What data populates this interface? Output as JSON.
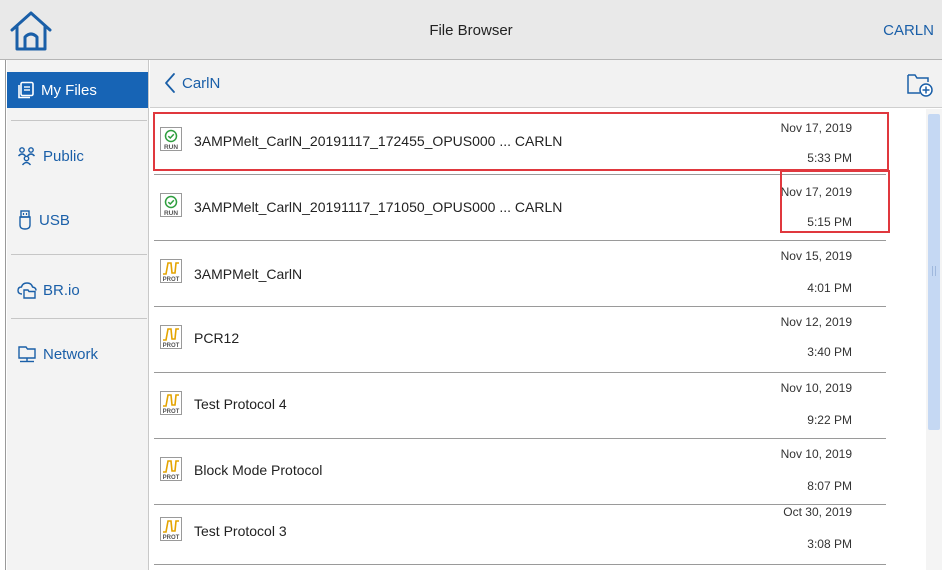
{
  "header": {
    "title": "File Browser",
    "user": "CARLN",
    "home_icon": "home-icon"
  },
  "sidebar": {
    "items": [
      {
        "label": "My Files",
        "icon": "my-files-icon",
        "active": true
      },
      {
        "label": "Public",
        "icon": "public-icon",
        "active": false
      },
      {
        "label": "USB",
        "icon": "usb-icon",
        "active": false
      },
      {
        "label": "BR.io",
        "icon": "cloud-folder-icon",
        "active": false
      },
      {
        "label": "Network",
        "icon": "network-icon",
        "active": false
      }
    ]
  },
  "toolbar": {
    "breadcrumb": "CarlN",
    "new_folder_icon": "new-folder-icon"
  },
  "files": [
    {
      "type": "RUN",
      "name": "3AMPMelt_CarlN_20191117_172455_OPUS000 ... CARLN",
      "date": "Nov 17, 2019",
      "time": "5:33 PM"
    },
    {
      "type": "RUN",
      "name": "3AMPMelt_CarlN_20191117_171050_OPUS000 ... CARLN",
      "date": "Nov 17, 2019",
      "time": "5:15 PM"
    },
    {
      "type": "PROT",
      "name": "3AMPMelt_CarlN",
      "date": "Nov 15, 2019",
      "time": "4:01 PM"
    },
    {
      "type": "PROT",
      "name": "PCR12",
      "date": "Nov 12, 2019",
      "time": "3:40 PM"
    },
    {
      "type": "PROT",
      "name": "Test Protocol 4",
      "date": "Nov 10, 2019",
      "time": "9:22 PM"
    },
    {
      "type": "PROT",
      "name": "Block Mode Protocol",
      "date": "Nov 10, 2019",
      "time": "8:07 PM"
    },
    {
      "type": "PROT",
      "name": "Test Protocol 3",
      "date": "Oct 30, 2019",
      "time": "3:08 PM"
    }
  ],
  "colors": {
    "accent": "#1764b5",
    "link": "#1a5fa8",
    "highlight": "#e0383e",
    "run_icon": "#2e9e3e",
    "prot_icon": "#e4a400"
  }
}
